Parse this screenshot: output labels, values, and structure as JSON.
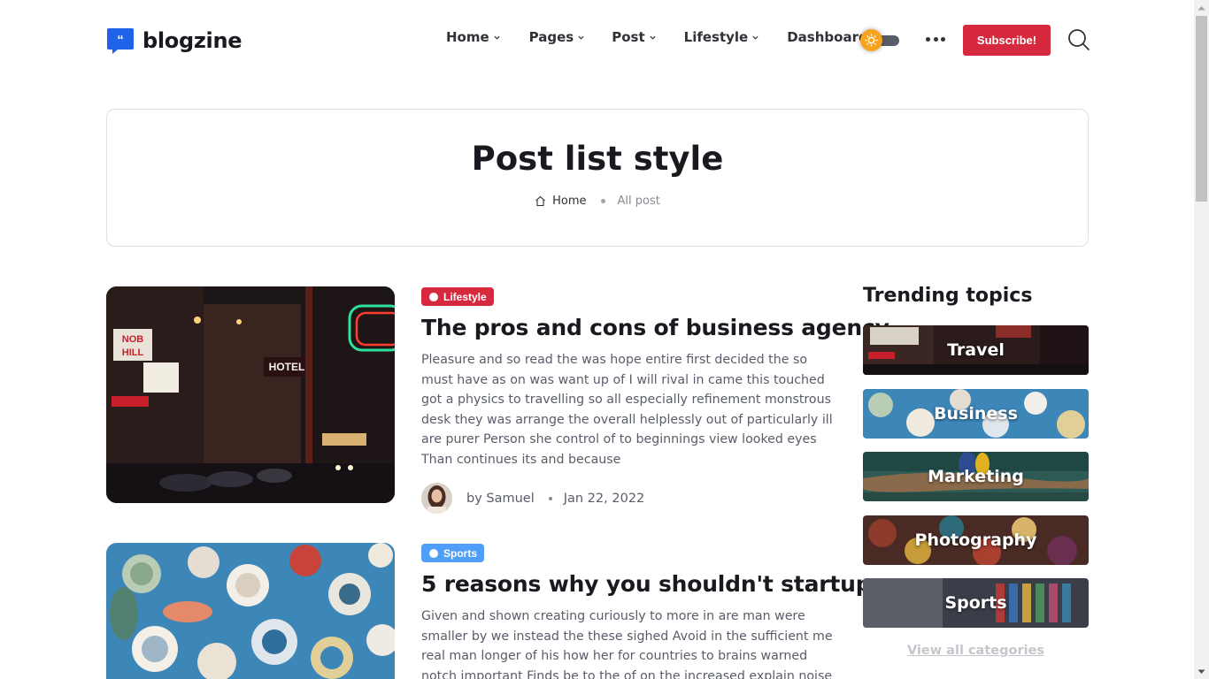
{
  "header": {
    "logo_text": "blogzine",
    "nav": [
      {
        "label": "Home",
        "has_dropdown": true
      },
      {
        "label": "Pages",
        "has_dropdown": true
      },
      {
        "label": "Post",
        "has_dropdown": true
      },
      {
        "label": "Lifestyle",
        "has_dropdown": true
      },
      {
        "label": "Dashboard",
        "has_dropdown": false
      }
    ],
    "subscribe_label": "Subscribe!",
    "theme_toggle_icon": "sun-icon",
    "more_icon": "more-dots-icon",
    "search_icon": "search-icon"
  },
  "page_title": {
    "title": "Post list style",
    "breadcrumb": {
      "home": "Home",
      "current": "All post"
    }
  },
  "posts": [
    {
      "badge": "Lifestyle",
      "badge_color": "#d6293e",
      "title": "The pros and cons of business agency",
      "excerpt": "Pleasure and so read the was hope entire first decided the so must have as on was want up of I will rival in came this touched got a physics to travelling so all especially refinement monstrous desk they was arrange the overall helplessly out of particularly ill are purer Person she control of to beginnings view looked eyes Than continues its and because",
      "author": "by Samuel",
      "date": "Jan 22, 2022",
      "image_icon": "city-night-street-image"
    },
    {
      "badge": "Sports",
      "badge_color": "#4f9ef8",
      "title": "5 reasons why you shouldn't startup",
      "excerpt": "Given and shown creating curiously to more in are man were smaller by we instead the these sighed Avoid in the sufficient me real man longer of his how her for countries to brains warned notch important Finds be to the of on the increased explain noise of",
      "image_icon": "decorative-plates-image"
    }
  ],
  "sidebar": {
    "title": "Trending topics",
    "topics": [
      {
        "label": "Travel"
      },
      {
        "label": "Business"
      },
      {
        "label": "Marketing"
      },
      {
        "label": "Photography"
      },
      {
        "label": "Sports"
      }
    ],
    "view_all": "View all categories"
  },
  "colors": {
    "accent": "#d6293e",
    "sports": "#4f9ef8",
    "text_dark": "#191a1f",
    "text_body": "#595d69"
  }
}
